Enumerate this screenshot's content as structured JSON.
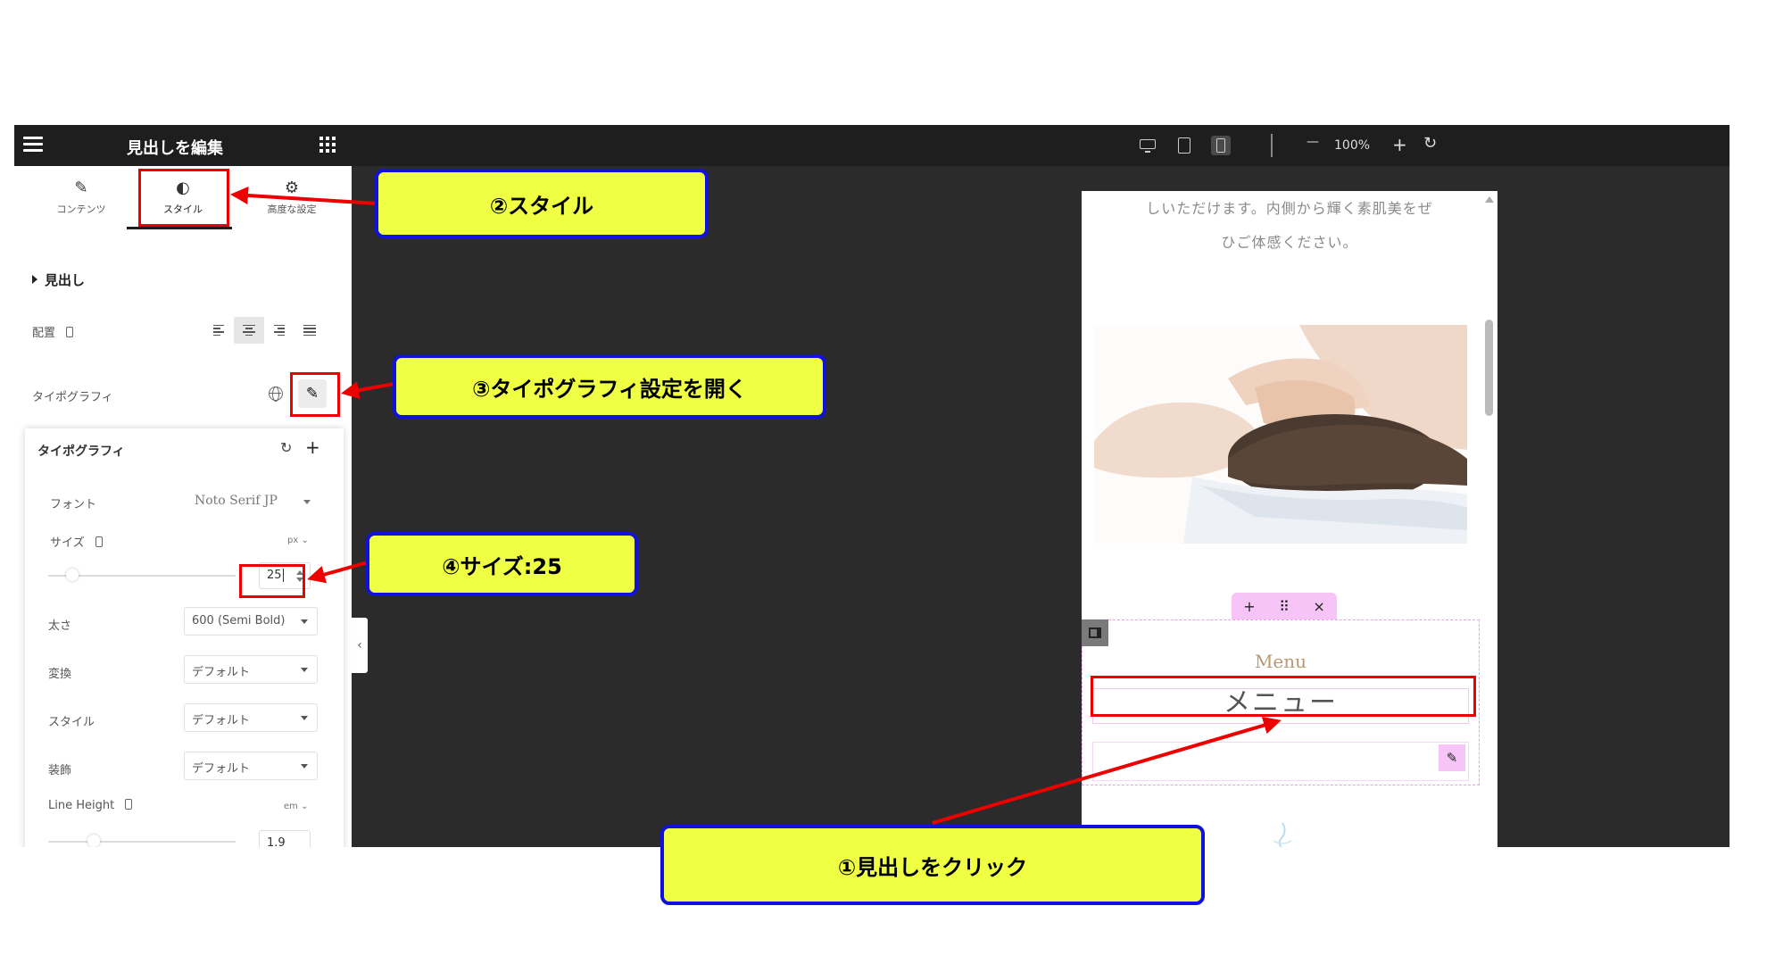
{
  "panel": {
    "title": "見出しを編集",
    "tabs": [
      {
        "label": "コンテンツ",
        "icon": "pencil-icon"
      },
      {
        "label": "スタイル",
        "icon": "contrast-icon"
      },
      {
        "label": "高度な設定",
        "icon": "gear-icon"
      }
    ],
    "section_title": "見出し",
    "alignment_label": "配置",
    "typography_label": "タイポグラフィ"
  },
  "typography_popover": {
    "title": "タイポグラフィ",
    "font_label": "フォント",
    "font_value": "Noto Serif JP",
    "size_label": "サイズ",
    "size_unit": "px",
    "size_value": "25",
    "weight_label": "太さ",
    "weight_value": "600 (Semi Bold)",
    "transform_label": "変換",
    "transform_value": "デフォルト",
    "style_label": "スタイル",
    "style_value": "デフォルト",
    "decoration_label": "装飾",
    "decoration_value": "デフォルト",
    "line_height_label": "Line Height",
    "line_height_unit": "em",
    "line_height_value": "1.9"
  },
  "topbar": {
    "zoom": "100%",
    "minus": "—",
    "plus": "+"
  },
  "preview": {
    "text_line1": "しいただけます。内側から輝く素肌美をぜ",
    "text_line2": "ひご体感ください。",
    "menu_subtitle": "Menu",
    "menu_heading": "メニュー"
  },
  "annotations": {
    "step1": "①見出しをクリック",
    "step2": "②スタイル",
    "step3": "③タイポグラフィ設定を開く",
    "step4": "④サイズ:25"
  },
  "colors": {
    "callout_fill": "#eeff44",
    "callout_border": "#1010e0",
    "highlight_red": "#ee0000",
    "editor_dark": "#1e1e1e",
    "selection_pink": "#f6c4f6"
  }
}
